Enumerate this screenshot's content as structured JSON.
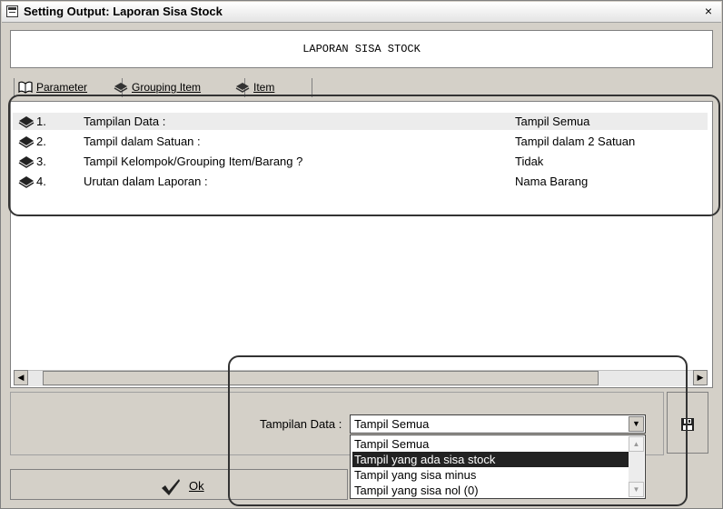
{
  "window": {
    "title": "Setting Output: Laporan Sisa Stock",
    "close_glyph": "×"
  },
  "report_title": "LAPORAN SISA STOCK",
  "tabs": [
    {
      "label": "Parameter",
      "icon": "open-book-icon"
    },
    {
      "label": "Grouping Item",
      "icon": "books-icon"
    },
    {
      "label": "Item",
      "icon": "books-icon"
    }
  ],
  "parameters": [
    {
      "number": "1.",
      "label": "Tampilan Data :",
      "value": "Tampil Semua"
    },
    {
      "number": "2.",
      "label": "Tampil dalam Satuan :",
      "value": "Tampil dalam 2 Satuan"
    },
    {
      "number": "3.",
      "label": "Tampil Kelompok/Grouping Item/Barang ?",
      "value": "Tidak"
    },
    {
      "number": "4.",
      "label": "Urutan dalam Laporan :",
      "value": "Nama Barang"
    }
  ],
  "editor": {
    "label": "Tampilan Data :",
    "selected": "Tampil Semua",
    "options": [
      "Tampil Semua",
      "Tampil yang ada sisa stock",
      "Tampil yang sisa minus",
      "Tampil yang sisa nol (0)"
    ],
    "highlighted_option": "Tampil yang ada sisa stock"
  },
  "buttons": {
    "ok_label": "Ok",
    "save_icon": "floppy-disk-icon"
  },
  "colors": {
    "selected_row": "#ececec",
    "highlight": "#222222",
    "dialog_bg": "#d4d0c8"
  }
}
